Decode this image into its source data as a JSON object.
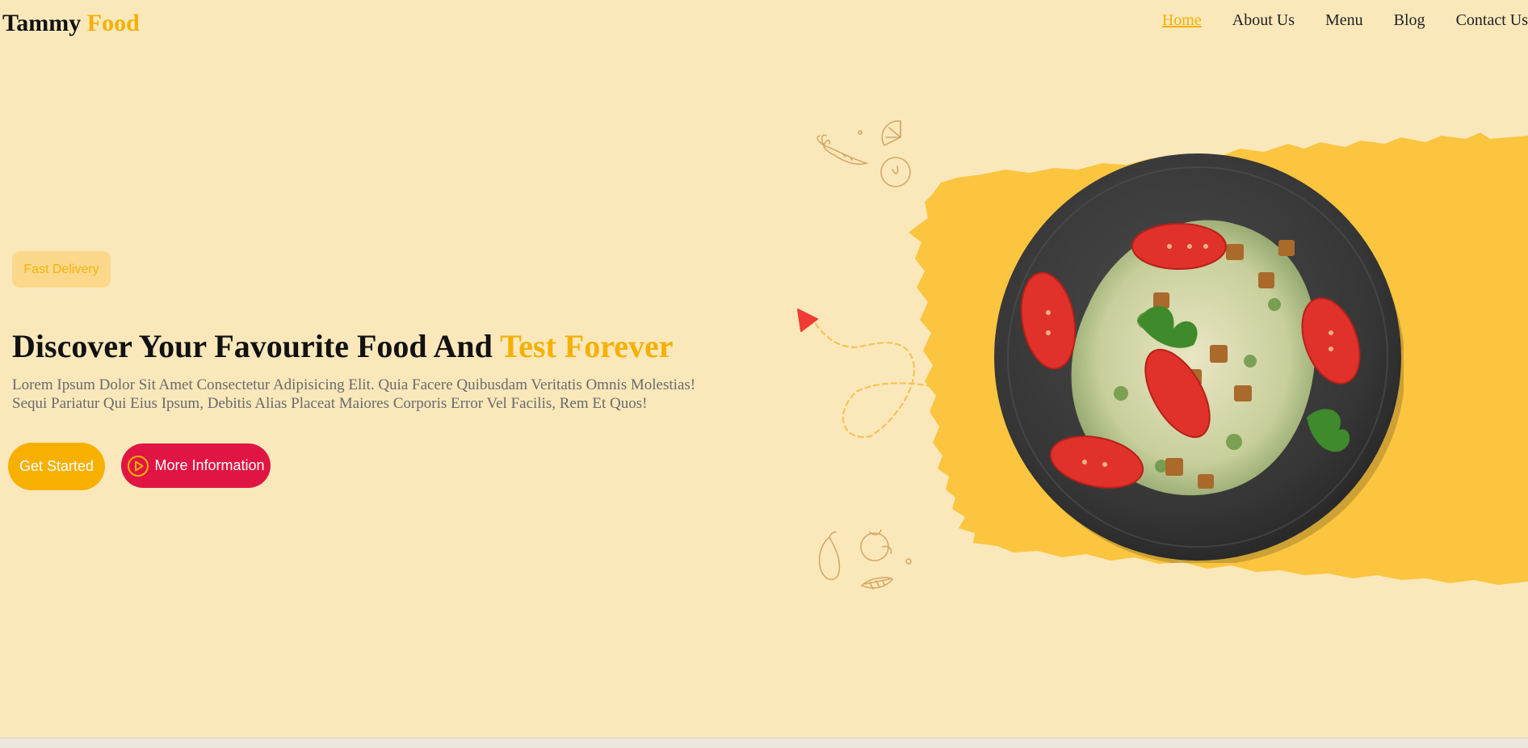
{
  "brand": {
    "name_part1": "Tammy",
    "name_part2": "Food"
  },
  "nav": {
    "items": [
      {
        "label": "Home",
        "active": true
      },
      {
        "label": "About Us",
        "active": false
      },
      {
        "label": "Menu",
        "active": false
      },
      {
        "label": "Blog",
        "active": false
      },
      {
        "label": "Contact Us",
        "active": false
      }
    ]
  },
  "hero": {
    "badge": "Fast Delivery",
    "headline_part1": "Discover Your Favourite Food And",
    "headline_part2": "Test Forever",
    "description_line1": "Lorem Ipsum Dolor Sit Amet Consectetur Adipisicing Elit. Quia Facere Quibusdam Veritatis Omnis Molestias!",
    "description_line2": "Sequi Pariatur Qui Eius Ipsum, Debitis Alias Placeat Maiores Corporis Error Vel Facilis, Rem Et Quos!",
    "get_started": "Get Started",
    "more_info": "More Information"
  },
  "icons": {
    "play": "play-circle-icon",
    "arrow": "paper-plane-arrow-icon",
    "doodle_top": "vegetable-doodle-icon",
    "doodle_bottom": "fruit-doodle-icon"
  },
  "colors": {
    "background": "#fae8bb",
    "accent": "#f6b000",
    "primary_button": "#f8b000",
    "secondary_button": "#e01543",
    "splash": "#fbc53f",
    "plate": "#3b3b3b"
  }
}
